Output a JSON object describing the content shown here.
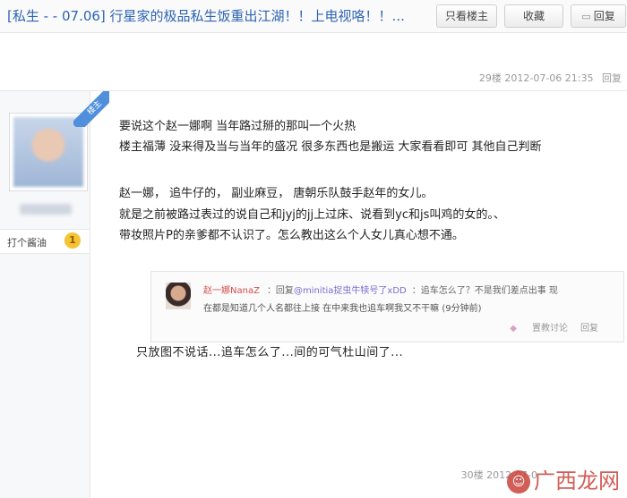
{
  "header": {
    "title": "[私生 - - 07.06] 行星家的极品私生饭重出江湖！！上电视咯！！...",
    "btn_only_op": "只看楼主",
    "btn_favorite": "收藏",
    "btn_reply": "回复"
  },
  "prev_floor": {
    "meta": "29楼  2012-07-06 21:35",
    "reply": "回复"
  },
  "user": {
    "badge": "楼主",
    "level_name": "打个酱油",
    "level_num": "1"
  },
  "post": {
    "owner_tag": "楼主",
    "line1": "要说这个赵一娜啊 当年路过掰的那叫一个火热",
    "line2": "楼主福薄 没来得及当与当年的盛况 很多东西也是搬运 大家看看即可 其他自己判断",
    "line3": "赵一娜， 追牛仔的， 副业麻豆， 唐朝乐队鼓手赵年的女儿。",
    "line4": "就是之前被路过表过的说自己和jyj的jj上过床、说看到yc和js叫鸡的女的。、",
    "line5": "带妆照片P的亲爹都不认识了。怎么教出这么个人女儿真心想不通。",
    "quote": {
      "name": "赵一娜NanaZ",
      "verb": "：回复",
      "link": "@minitia捉虫牛犊号了xDD",
      "text1": "：追车怎么了？不是我们差点出事 现",
      "line2": "在都是知道几个人名都往上接 在中来我也追车啊我又不干嘛 (9分钟前)",
      "action1": "置教讨论",
      "action2": "回复"
    },
    "caption": "只放图不说话...追车怎么了...间的可气杜山间了..."
  },
  "next_floor": {
    "meta": "30楼  2012-07-0"
  },
  "watermark": "广西龙网",
  "colors": {
    "title": "#2d64b3",
    "accent_blue": "#4a8fd8",
    "quote_name": "#d54b4b",
    "watermark": "#c9423a"
  }
}
